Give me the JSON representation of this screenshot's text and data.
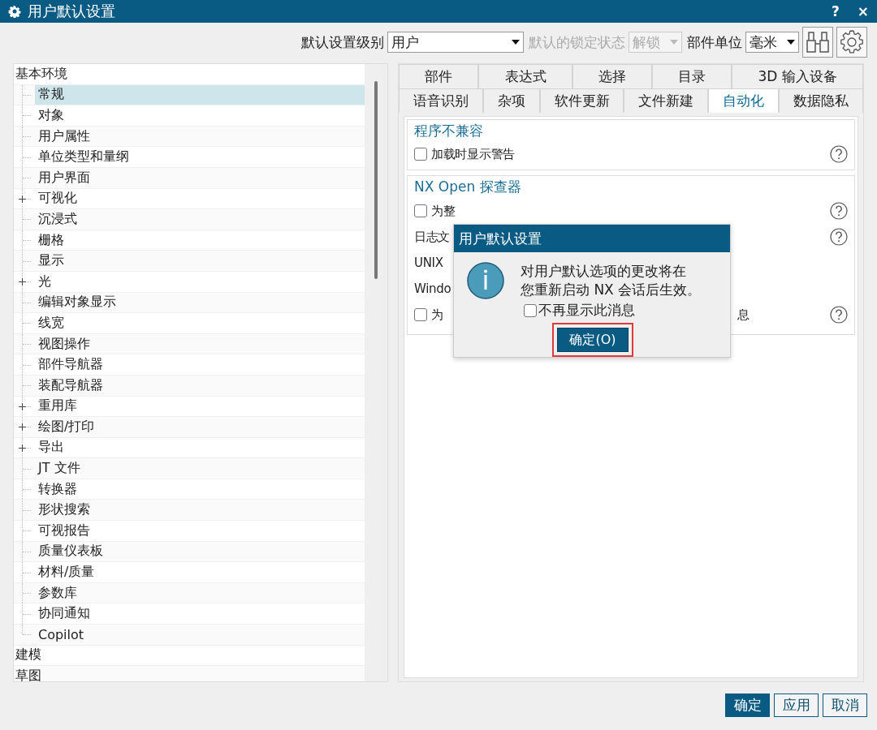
{
  "window": {
    "title": "用户默认设置",
    "help": "?",
    "close": "×"
  },
  "toolbar": {
    "fields": [
      {
        "label": "默认设置级别",
        "value": "用户",
        "disabled": false
      },
      {
        "label": "默认的锁定状态",
        "value": "解锁",
        "disabled": true
      },
      {
        "label": "部件单位",
        "value": "毫米",
        "disabled": false
      }
    ]
  },
  "tree": [
    {
      "label": "基本环境",
      "selected": false,
      "children": [
        {
          "label": "常规",
          "selected": true,
          "collapsed": false
        },
        {
          "label": "对象",
          "selected": false,
          "collapsed": false
        },
        {
          "label": "用户属性",
          "selected": false,
          "collapsed": false
        },
        {
          "label": "单位类型和量纲",
          "selected": false,
          "collapsed": false
        },
        {
          "label": "用户界面",
          "selected": false,
          "collapsed": false
        },
        {
          "label": "可视化",
          "selected": false,
          "collapsed": true
        },
        {
          "label": "沉浸式",
          "selected": false,
          "collapsed": false
        },
        {
          "label": "栅格",
          "selected": false,
          "collapsed": false
        },
        {
          "label": "显示",
          "selected": false,
          "collapsed": false
        },
        {
          "label": "光",
          "selected": false,
          "collapsed": true
        },
        {
          "label": "编辑对象显示",
          "selected": false,
          "collapsed": false
        },
        {
          "label": "线宽",
          "selected": false,
          "collapsed": false
        },
        {
          "label": "视图操作",
          "selected": false,
          "collapsed": false
        },
        {
          "label": "部件导航器",
          "selected": false,
          "collapsed": false
        },
        {
          "label": "装配导航器",
          "selected": false,
          "collapsed": false
        },
        {
          "label": "重用库",
          "selected": false,
          "collapsed": true
        },
        {
          "label": "绘图/打印",
          "selected": false,
          "collapsed": true
        },
        {
          "label": "导出",
          "selected": false,
          "collapsed": true
        },
        {
          "label": "JT 文件",
          "selected": false,
          "collapsed": false
        },
        {
          "label": "转换器",
          "selected": false,
          "collapsed": false
        },
        {
          "label": "形状搜索",
          "selected": false,
          "collapsed": false
        },
        {
          "label": "可视报告",
          "selected": false,
          "collapsed": false
        },
        {
          "label": "质量仪表板",
          "selected": false,
          "collapsed": false
        },
        {
          "label": "材料/质量",
          "selected": false,
          "collapsed": false
        },
        {
          "label": "参数库",
          "selected": false,
          "collapsed": false
        },
        {
          "label": "协同通知",
          "selected": false,
          "collapsed": false
        },
        {
          "label": "Copilot",
          "selected": false,
          "collapsed": false
        }
      ]
    },
    {
      "label": "建模",
      "selected": false
    },
    {
      "label": "草图",
      "selected": false
    }
  ],
  "tab_rows": [
    [
      {
        "label": "部件",
        "selected": false
      },
      {
        "label": "表达式",
        "selected": false
      },
      {
        "label": "选择",
        "selected": false
      },
      {
        "label": "目录",
        "selected": false
      },
      {
        "label": "3D 输入设备",
        "selected": false
      }
    ],
    [
      {
        "label": "语音识别",
        "selected": false
      },
      {
        "label": "杂项",
        "selected": false
      },
      {
        "label": "软件更新",
        "selected": false
      },
      {
        "label": "文件新建",
        "selected": false
      },
      {
        "label": "自动化",
        "selected": true
      },
      {
        "label": "数据隐私",
        "selected": false
      }
    ]
  ],
  "groups": [
    {
      "title": "程序不兼容",
      "rows": [
        {
          "kind": "checkbox",
          "label": "加载时显示警告",
          "checked": false,
          "help": true
        }
      ]
    },
    {
      "title": "NX Open 探查器",
      "rows": [
        {
          "kind": "checkbox",
          "label": "为整",
          "checked": false,
          "help": true
        },
        {
          "kind": "text",
          "label": "日志文",
          "help": true
        },
        {
          "kind": "text",
          "label": "UNIX",
          "help": false
        },
        {
          "kind": "text",
          "label": "Windo",
          "help": false
        },
        {
          "kind": "checkbox",
          "label": "为",
          "tail": "息",
          "checked": false,
          "help": true
        }
      ]
    }
  ],
  "dialog": {
    "title": "用户默认设置",
    "message": [
      "对用户默认选项的更改将在",
      "您重新启动 NX 会话后生效。"
    ],
    "checkbox": {
      "label": "不再显示此消息",
      "checked": false
    },
    "button": {
      "label": "确定(O)",
      "focused": true
    }
  },
  "buttons": [
    {
      "label": "确定",
      "primary": true
    },
    {
      "label": "应用",
      "primary": false
    },
    {
      "label": "取消",
      "primary": false
    }
  ]
}
